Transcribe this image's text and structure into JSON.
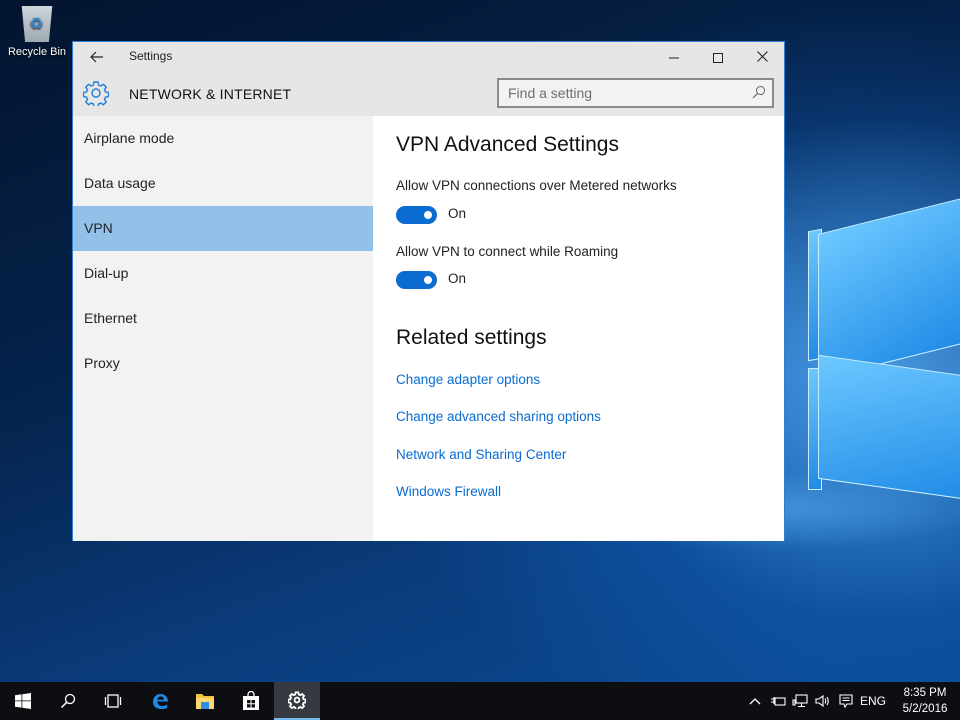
{
  "desktop": {
    "icons": [
      {
        "label": "Recycle Bin",
        "icon": "recycle-bin-icon"
      }
    ]
  },
  "window": {
    "app_title": "Settings",
    "section_title": "NETWORK & INTERNET",
    "controls": {
      "minimize": "—",
      "close": "✕"
    },
    "search": {
      "placeholder": "Find a setting",
      "value": ""
    }
  },
  "sidebar": {
    "selected": "VPN",
    "items": [
      {
        "label": "Airplane mode"
      },
      {
        "label": "Data usage"
      },
      {
        "label": "VPN"
      },
      {
        "label": "Dial-up"
      },
      {
        "label": "Ethernet"
      },
      {
        "label": "Proxy"
      }
    ]
  },
  "content": {
    "title": "VPN Advanced Settings",
    "options": [
      {
        "label": "Allow VPN connections over Metered networks",
        "state": "On",
        "enabled": true
      },
      {
        "label": "Allow VPN to connect while Roaming",
        "state": "On",
        "enabled": true
      }
    ],
    "related_title": "Related settings",
    "related_links": [
      {
        "label": "Change adapter options"
      },
      {
        "label": "Change advanced sharing options"
      },
      {
        "label": "Network and Sharing Center"
      },
      {
        "label": "Windows Firewall"
      }
    ]
  },
  "taskbar": {
    "apps": [
      {
        "name": "start",
        "icon": "windows-logo-icon"
      },
      {
        "name": "search",
        "icon": "search-icon"
      },
      {
        "name": "task-view",
        "icon": "task-view-icon"
      },
      {
        "name": "edge",
        "icon": "edge-icon"
      },
      {
        "name": "file-explorer",
        "icon": "folder-icon"
      },
      {
        "name": "store",
        "icon": "store-icon"
      },
      {
        "name": "settings",
        "icon": "gear-icon",
        "active": true
      }
    ],
    "tray": {
      "language": "ENG",
      "time": "8:35 PM",
      "date": "5/2/2016"
    }
  },
  "colors": {
    "accent": "#0a6bd0",
    "selection": "#91c0e8",
    "window_border": "#2d7fd3",
    "taskbar": "#0c0e12"
  }
}
